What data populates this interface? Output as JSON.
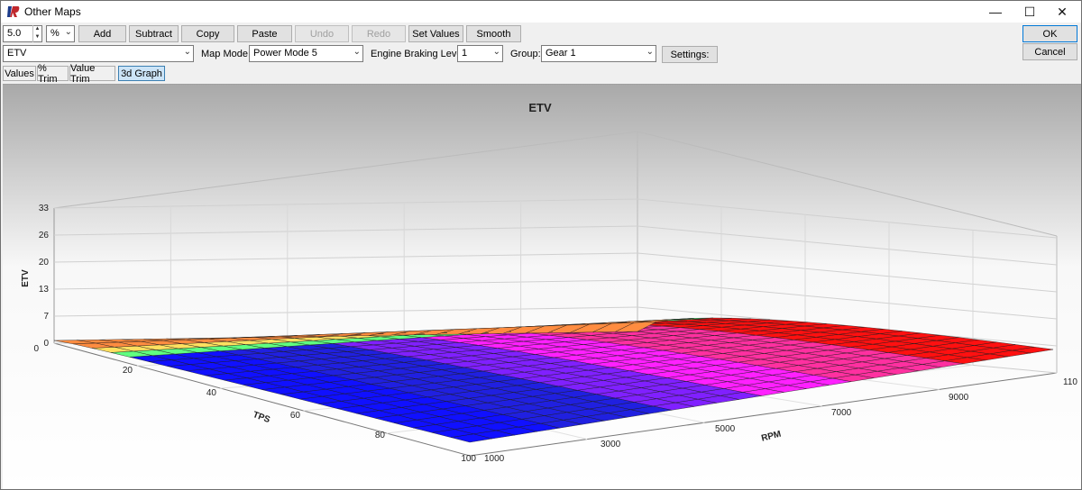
{
  "window": {
    "title": "Other Maps"
  },
  "toolbar": {
    "step_value": "5.0",
    "step_unit": "%",
    "buttons": [
      {
        "label": "Add",
        "enabled": true
      },
      {
        "label": "Subtract",
        "enabled": true
      },
      {
        "label": "Copy",
        "enabled": true
      },
      {
        "label": "Paste",
        "enabled": true
      },
      {
        "label": "Undo",
        "enabled": false
      },
      {
        "label": "Redo",
        "enabled": false
      },
      {
        "label": "Set Values",
        "enabled": true
      },
      {
        "label": "Smooth",
        "enabled": true
      }
    ],
    "ok_label": "OK",
    "cancel_label": "Cancel"
  },
  "selectors": {
    "map": "ETV",
    "map_mode_label": "Map Mode:",
    "map_mode": "Power Mode 5",
    "engine_braking_label": "Engine Braking Level:",
    "engine_braking": "1",
    "group_label": "Group:",
    "group": "Gear 1",
    "settings_label": "Settings:"
  },
  "tabs": [
    {
      "label": "Values",
      "active": false
    },
    {
      "label": "% Trim",
      "active": false
    },
    {
      "label": "Value Trim",
      "active": false
    },
    {
      "label": "3d Graph",
      "active": true
    }
  ],
  "chart_data": {
    "type": "surface3d",
    "title": "ETV",
    "zlabel": "ETV",
    "xlabel": "TPS",
    "ylabel": "RPM",
    "z_ticks": [
      "0",
      "7",
      "13",
      "20",
      "26",
      "33"
    ],
    "x_ticks": [
      "0",
      "20",
      "40",
      "60",
      "80",
      "100"
    ],
    "y_ticks": [
      "1000",
      "3000",
      "5000",
      "7000",
      "9000",
      "110"
    ],
    "zlim": [
      0,
      33
    ],
    "colors": [
      "#ff8c40",
      "#ffe060",
      "#60ff80",
      "#30e0ff",
      "#1010ff",
      "#2020e0",
      "#8020ff",
      "#ff20ff",
      "#ff30a0",
      "#ff1010"
    ]
  }
}
